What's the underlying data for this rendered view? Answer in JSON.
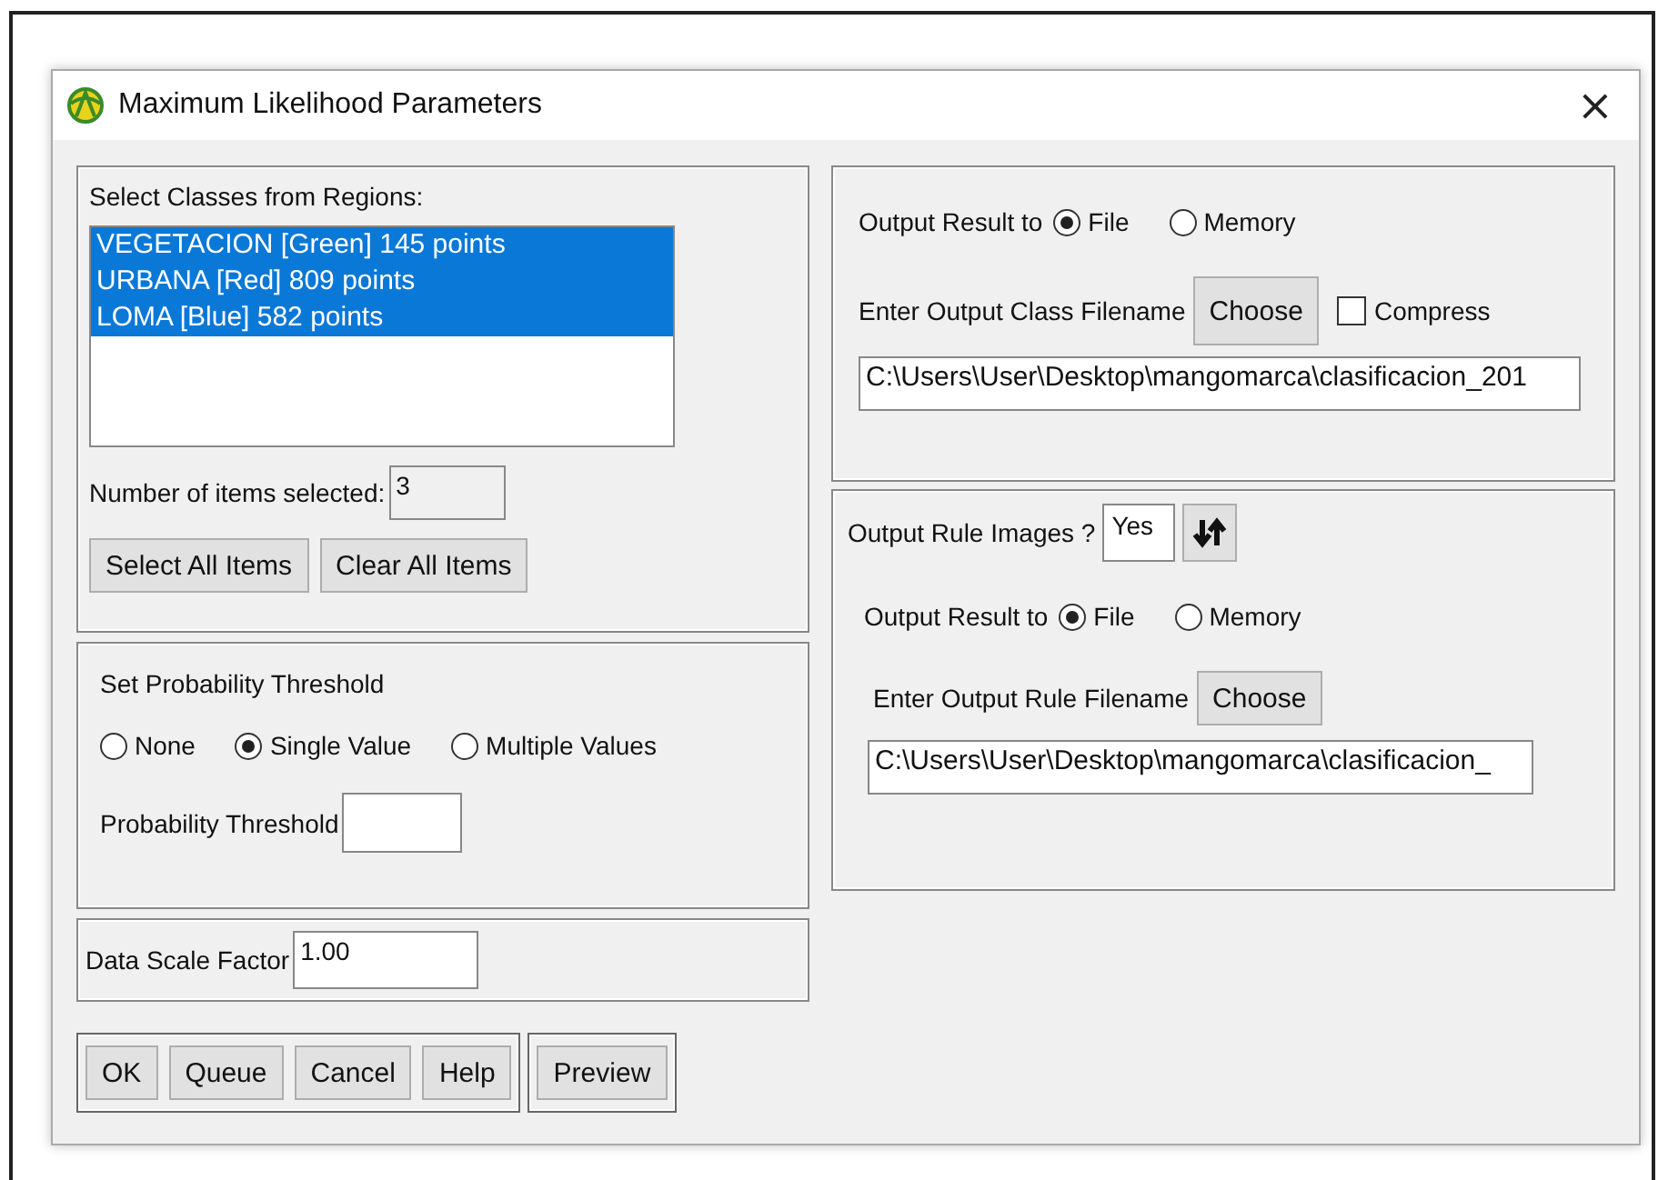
{
  "window": {
    "title": "Maximum Likelihood Parameters",
    "close": "×"
  },
  "classes": {
    "label": "Select Classes from Regions:",
    "items": [
      {
        "text": "VEGETACION [Green] 145 points",
        "selected": true
      },
      {
        "text": "URBANA [Red] 809 points",
        "selected": true
      },
      {
        "text": "LOMA [Blue] 582 points",
        "selected": true
      }
    ],
    "count_label": "Number of items selected:",
    "count_value": "3",
    "buttons": [
      "Select All Items",
      "Clear All Items"
    ]
  },
  "threshold": {
    "title": "Set Probability Threshold",
    "options": [
      {
        "label": "None",
        "selected": false
      },
      {
        "label": "Single Value",
        "selected": true
      },
      {
        "label": "Multiple Values",
        "selected": false
      }
    ],
    "field_label": "Probability Threshold"
  },
  "scale": {
    "label": "Data Scale Factor",
    "value": "1.00"
  },
  "buttons": [
    "OK",
    "Queue",
    "Cancel",
    "Help"
  ],
  "preview": "Preview",
  "output_class": {
    "result_label": "Output Result to",
    "options": [
      {
        "label": "File",
        "selected": true
      },
      {
        "label": "Memory",
        "selected": false
      }
    ],
    "filename_label": "Enter Output Class Filename",
    "choose": "Choose",
    "compress": {
      "label": "Compress",
      "checked": false
    },
    "path": "C:\\Users\\User\\Desktop\\mangomarca\\clasificacion_201"
  },
  "rule": {
    "label": "Output Rule Images ?",
    "toggle_value": "Yes",
    "result_label": "Output Result to",
    "options": [
      {
        "label": "File",
        "selected": true
      },
      {
        "label": "Memory",
        "selected": false
      }
    ],
    "filename_label": "Enter Output Rule Filename",
    "choose": "Choose",
    "path": "C:\\Users\\User\\Desktop\\mangomarca\\clasificacion_"
  }
}
